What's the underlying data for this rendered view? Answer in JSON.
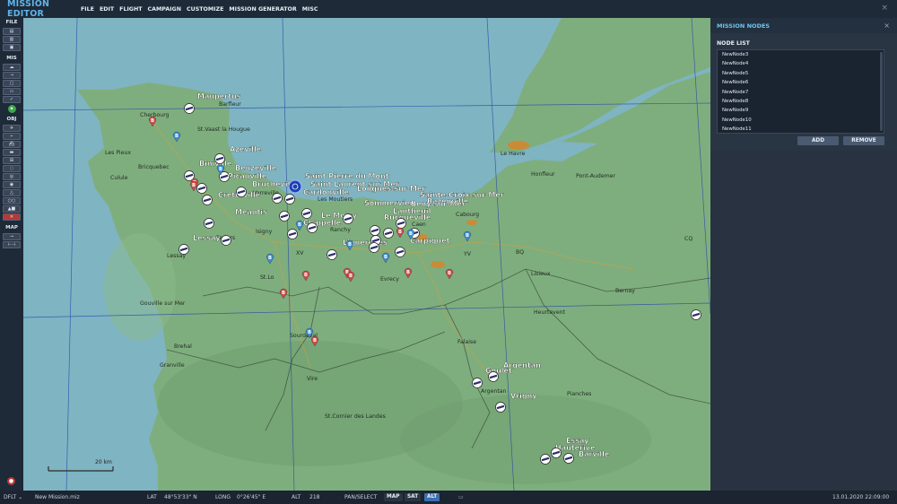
{
  "app": {
    "title": "MISSION EDITOR",
    "close_glyph": "×"
  },
  "menu": [
    "FILE",
    "EDIT",
    "FLIGHT",
    "CAMPAIGN",
    "CUSTOMIZE",
    "MISSION GENERATOR",
    "MISC"
  ],
  "toolbar": {
    "sections": {
      "file": "FILE",
      "mis": "MIS",
      "obj": "OBJ",
      "map": "MAP"
    },
    "file_buttons": [
      "file-new-icon",
      "file-open-icon",
      "file-save-icon"
    ],
    "mis_buttons": [
      "weather-icon",
      "route-icon",
      "triggers-icon",
      "briefing-icon",
      "check-icon"
    ],
    "obj_buttons": [
      "air-group-icon",
      "helicopter-group-icon",
      "ship-group-icon",
      "vehicle-group-icon",
      "static-object-icon",
      "zone-icon",
      "target-icon",
      "nav-point-icon",
      "shape-icon",
      "delete-icon"
    ],
    "map_buttons": [
      "measure-icon",
      "ruler-icon"
    ]
  },
  "map": {
    "cities": [
      {
        "name": "Barfleur"
      },
      {
        "name": "Cherbourg"
      },
      {
        "name": "St.Vaast la Hougue"
      },
      {
        "name": "Les Pieux"
      },
      {
        "name": "Bricquebec"
      },
      {
        "name": "Culule"
      },
      {
        "name": "Varreville"
      },
      {
        "name": "Les Moutiers"
      },
      {
        "name": "Isigny"
      },
      {
        "name": "Ranchy"
      },
      {
        "name": "Caen"
      },
      {
        "name": "Cabourg"
      },
      {
        "name": "Le Havre"
      },
      {
        "name": "Honfleur"
      },
      {
        "name": "Pont-Audemer"
      },
      {
        "name": "Lessay"
      },
      {
        "name": "Periers"
      },
      {
        "name": "XV"
      },
      {
        "name": "St.Lo"
      },
      {
        "name": "Evrecy"
      },
      {
        "name": "YV"
      },
      {
        "name": "BQ"
      },
      {
        "name": "Lisieux"
      },
      {
        "name": "CQ"
      },
      {
        "name": "Bernay"
      },
      {
        "name": "Gouville sur Mer"
      },
      {
        "name": "Heurtevent"
      },
      {
        "name": "Brehal"
      },
      {
        "name": "Sourdeval"
      },
      {
        "name": "Falaise"
      },
      {
        "name": "Granville"
      },
      {
        "name": "Vire"
      },
      {
        "name": "Argentan"
      },
      {
        "name": "Pianches"
      },
      {
        "name": "St.Cornier des Landes"
      }
    ],
    "airfields": [
      {
        "name": "Maupertus"
      },
      {
        "name": "Azeville"
      },
      {
        "name": "Biniville"
      },
      {
        "name": "Beuzeville"
      },
      {
        "name": "Picauville"
      },
      {
        "name": "Brucheville"
      },
      {
        "name": "Cretteville"
      },
      {
        "name": "Saint Pierre du Mont"
      },
      {
        "name": "Saint Laurent sur Mer"
      },
      {
        "name": "Longues-sur-Mer"
      },
      {
        "name": "Cardonville"
      },
      {
        "name": "Sainte-Croix-sur-Mer"
      },
      {
        "name": "Bazenville"
      },
      {
        "name": "Beny-sur-Mer"
      },
      {
        "name": "Sommervieu"
      },
      {
        "name": "Lantheuil"
      },
      {
        "name": "Rucqueville"
      },
      {
        "name": "Meautis"
      },
      {
        "name": "Le Molay"
      },
      {
        "name": "Chippelle"
      },
      {
        "name": "Lessay"
      },
      {
        "name": "Lignerolles"
      },
      {
        "name": "Carpiquet"
      },
      {
        "name": "Argentan"
      },
      {
        "name": "Goulet"
      },
      {
        "name": "Vrigny"
      },
      {
        "name": "Essay"
      },
      {
        "name": "Hauterive"
      },
      {
        "name": "Barville"
      }
    ],
    "scale_label": "20 km",
    "colors": {
      "sea": "#7fb4c2",
      "land": "#7aa87a",
      "grid": "#2448a8",
      "red_marker": "#d24a4a",
      "blue_marker": "#3a8fd8"
    }
  },
  "panel": {
    "title": "MISSION NODES",
    "close_glyph": "×",
    "node_list_label": "NODE LIST",
    "nodes": [
      "NewNode3",
      "NewNode4",
      "NewNode5",
      "NewNode6",
      "NewNode7",
      "NewNode8",
      "NewNode9",
      "NewNode10",
      "NewNode11"
    ],
    "add_label": "ADD",
    "remove_label": "REMOVE"
  },
  "status": {
    "profile": "DFLT",
    "profile_arrow": "⌄",
    "mission_file": "New Mission.miz",
    "lat_label": "LAT",
    "lat_value": "48°53'33\" N",
    "long_label": "LONG",
    "long_value": "0°26'45\" E",
    "alt_label": "ALT",
    "alt_value": "218",
    "mode": "PAN/SELECT",
    "map_btn": "MAP",
    "sat_btn": "SAT",
    "alt_btn": "ALT",
    "datetime": "13.01.2020 22:09:00"
  }
}
